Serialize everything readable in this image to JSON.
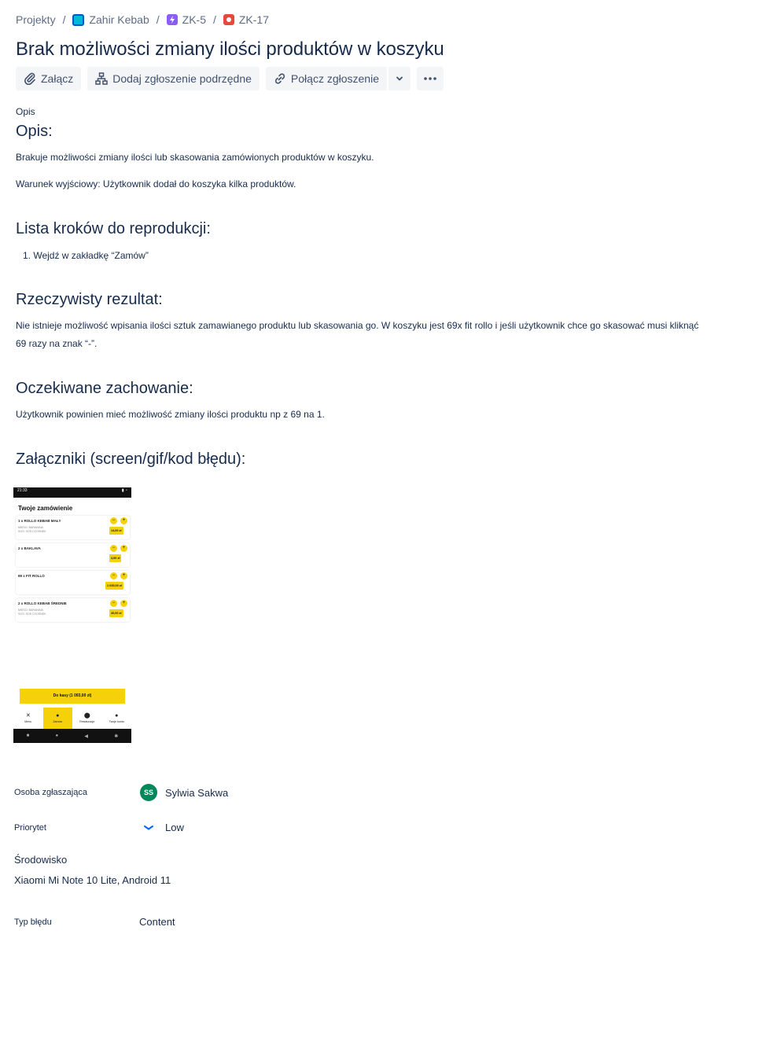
{
  "breadcrumb": {
    "projects": "Projekty",
    "project": "Zahir Kebab",
    "epic": "ZK-5",
    "issue": "ZK-17",
    "separator": "/"
  },
  "issue": {
    "title": "Brak możliwości zmiany ilości produktów w koszyku"
  },
  "toolbar": {
    "attach": "Załącz",
    "add_child": "Dodaj zgłoszenie podrzędne",
    "link_issue": "Połącz zgłoszenie"
  },
  "description": {
    "field_label": "Opis",
    "heading": "Opis:",
    "p1": "Brakuje możliwości zmiany ilości lub skasowania zamówionych produktów w koszyku.",
    "p2": "Warunek wyjściowy: Użytkownik dodał do koszyka kilka produktów.",
    "steps_heading": "Lista kroków do reprodukcji:",
    "steps": [
      "Wejdź w zakładkę “Zamów”"
    ],
    "actual_heading": "Rzeczywisty rezultat:",
    "actual_line1": "Nie istnieje możliwość wpisania ilości sztuk zamawianego produktu lub skasowania go. W koszyku jest 69x fit rollo i jeśli użytkownik chce go skasować musi kliknąć",
    "actual_line2": "69 razy na znak “-”.",
    "expected_heading": "Oczekiwane zachowanie:",
    "expected": "Użytkownik powinien mieć możliwość zmiany ilości produktu np z 69 na 1.",
    "attachments_heading": "Załączniki (screen/gif/kod błędu):"
  },
  "attachment_screenshot": {
    "time": "21:33",
    "status_icons": "▮ ◔",
    "title": "Twoje zamówienie",
    "orders": [
      {
        "name": "1 x ROLLO KEBAB MAŁY",
        "desc1": "MIĘSO: BARANINA",
        "desc2": "SOS: SOS CZOSNEK",
        "price": "14,00 zł"
      },
      {
        "name": "2 x BAKLAVA",
        "desc1": "",
        "desc2": "",
        "price": "4,00 zł"
      },
      {
        "name": "69 x FIT ROLLO",
        "desc1": "",
        "desc2": "",
        "price": "1 035,00 zł"
      },
      {
        "name": "2 x ROLLO KEBAB ŚREDNIE",
        "desc1": "MIĘSO: BARANINA",
        "desc2": "SOS: SOS CZOSNEK",
        "price": "40,00 zł"
      }
    ],
    "minus": "−",
    "plus": "+",
    "checkout": "Do kasy (1 093,00 zł)",
    "tabs": [
      {
        "icon": "✕",
        "label": "Menu"
      },
      {
        "icon": "●",
        "label": "Zamów"
      },
      {
        "icon": "⬤",
        "label": "Restauracje"
      },
      {
        "icon": "●",
        "label": "Twoje konto"
      }
    ]
  },
  "fields": {
    "reporter_label": "Osoba zgłaszająca",
    "reporter_initials": "SS",
    "reporter_name": "Sylwia Sakwa",
    "priority_label": "Priorytet",
    "priority_value": "Low",
    "environment_label": "Środowisko",
    "environment_value": "Xiaomi Mi Note 10 Lite, Android 11",
    "bug_type_label": "Typ błędu",
    "bug_type_value": "Content"
  },
  "colors": {
    "text": "#172b4d",
    "muted": "#5e6c84",
    "button_bg": "#f4f5f7",
    "avatar": "#00875a",
    "priority_low": "#0065ff",
    "app_yellow": "#f5d10a"
  }
}
